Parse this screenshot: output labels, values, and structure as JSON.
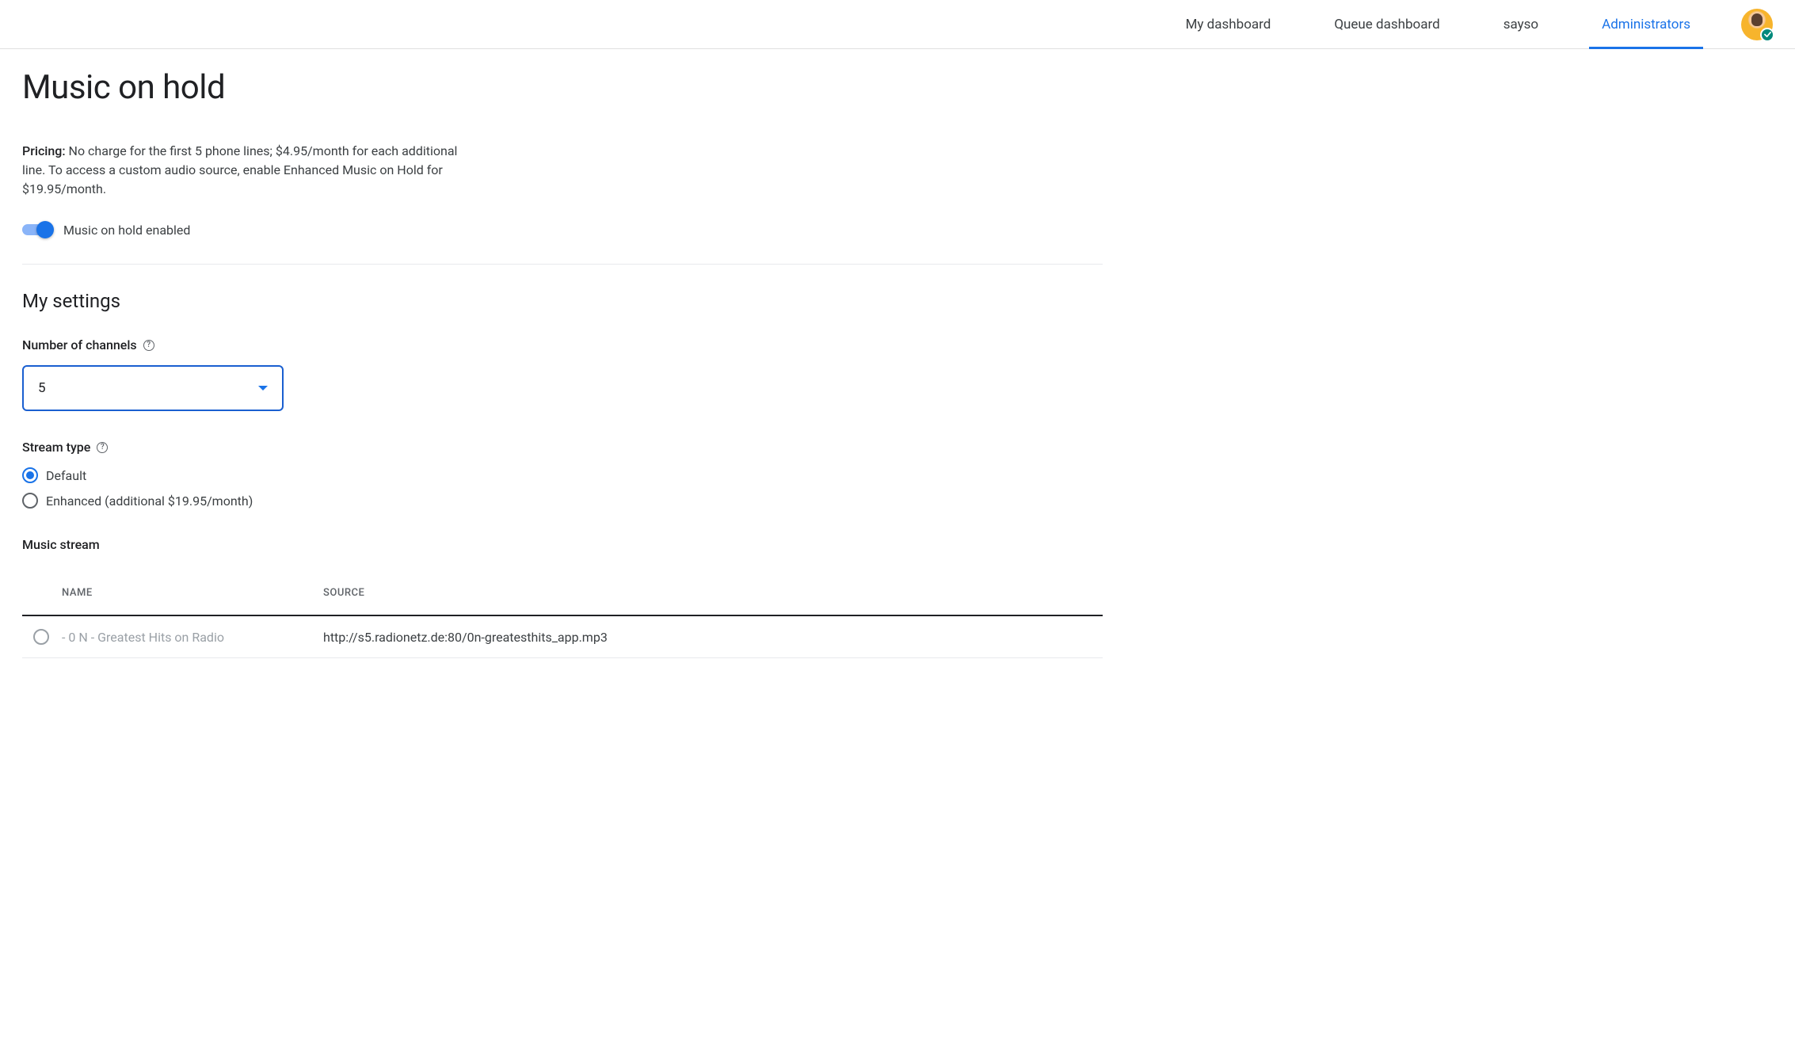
{
  "nav": {
    "tabs": [
      {
        "label": "My dashboard",
        "active": false
      },
      {
        "label": "Queue dashboard",
        "active": false
      },
      {
        "label": "sayso",
        "active": false
      },
      {
        "label": "Administrators",
        "active": true
      }
    ]
  },
  "page": {
    "title": "Music on hold",
    "pricing_label": "Pricing:",
    "pricing_text": " No charge for the first 5 phone lines; $4.95/month for each additional line. To access a custom audio source, enable Enhanced Music on Hold for $19.95/month.",
    "toggle_label": "Music on hold enabled",
    "toggle_on": true
  },
  "settings": {
    "title": "My settings",
    "channels": {
      "label": "Number of channels",
      "value": "5"
    },
    "stream_type": {
      "label": "Stream type",
      "options": [
        {
          "label": "Default",
          "selected": true
        },
        {
          "label": "Enhanced (additional $19.95/month)",
          "selected": false
        }
      ]
    },
    "music_stream": {
      "label": "Music stream",
      "columns": {
        "name": "NAME",
        "source": "SOURCE"
      },
      "rows": [
        {
          "name": "- 0 N - Greatest Hits on Radio",
          "source": "http://s5.radionetz.de:80/0n-greatesthits_app.mp3",
          "selected": false
        }
      ]
    }
  }
}
